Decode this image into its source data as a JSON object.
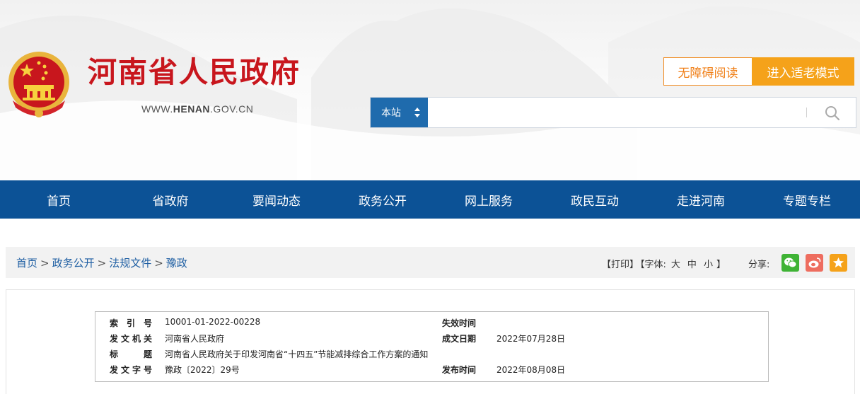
{
  "site": {
    "name": "河南省人民政府",
    "url_prefix": "WWW.",
    "url_domain": "HENAN",
    "url_suffix": ".GOV.CN",
    "brand_color": "#c8161d"
  },
  "header": {
    "accessibility_label": "无障碍阅读",
    "elder_mode_label": "进入适老模式",
    "search": {
      "scope_label": "本站",
      "placeholder": ""
    }
  },
  "nav": {
    "items": [
      "首页",
      "省政府",
      "要闻动态",
      "政务公开",
      "网上服务",
      "政民互动",
      "走进河南",
      "专题专栏"
    ],
    "color": "#0c5296"
  },
  "breadcrumb": {
    "items": [
      "首页",
      "政务公开",
      "法规文件",
      "豫政"
    ],
    "separator": ">"
  },
  "tools": {
    "print": "【打印】",
    "font_label": "【字体:",
    "font_large": "大",
    "font_medium": "中",
    "font_small": "小",
    "font_close": "】",
    "share_label": "分享:"
  },
  "meta": {
    "index_label": "索 引 号",
    "index_value": "10001-01-2022-00228",
    "expiry_label": "失效时间",
    "expiry_value": "",
    "issuer_label": "发文机关",
    "issuer_value": "河南省人民政府",
    "created_label": "成文日期",
    "created_value": "2022年07月28日",
    "title_label": "标 题",
    "title_value": "河南省人民政府关于印发河南省“十四五”节能减排综合工作方案的通知",
    "docno_label": "发文字号",
    "docno_value": "豫政〔2022〕29号",
    "published_label": "发布时间",
    "published_value": "2022年08月08日"
  }
}
